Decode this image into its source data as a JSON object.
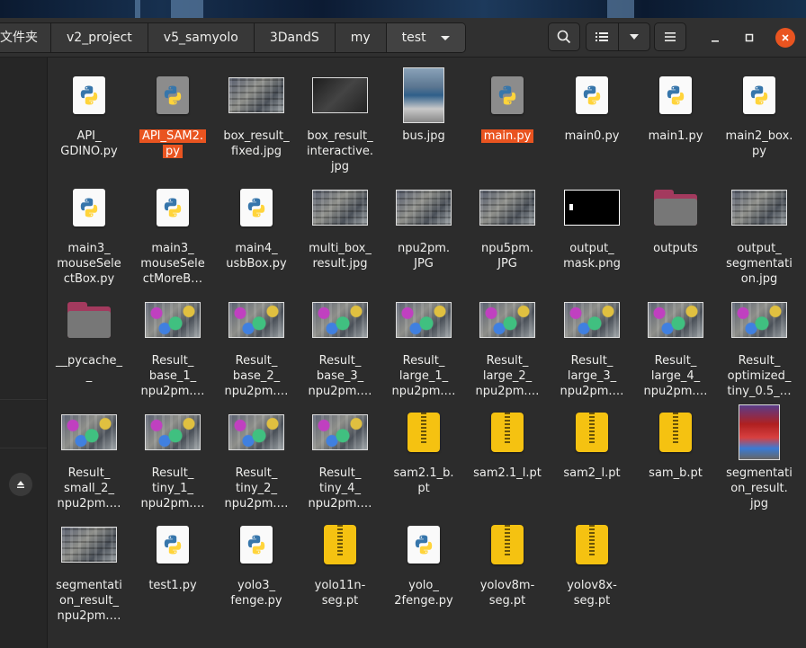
{
  "header": {
    "breadcrumbs": [
      "文件夹",
      "v2_project",
      "v5_samyolo",
      "3DandS",
      "my",
      "test"
    ]
  },
  "files": [
    {
      "label": "API_\nGDINO.py",
      "type": "python",
      "selected": false
    },
    {
      "label": "API_SAM2.\npy",
      "type": "python",
      "selected": true
    },
    {
      "label": "box_result_\nfixed.jpg",
      "type": "aerial",
      "selected": false
    },
    {
      "label": "box_result_\ninteractive.\njpg",
      "type": "dark",
      "selected": false
    },
    {
      "label": "bus.jpg",
      "type": "bus",
      "selected": false
    },
    {
      "label": "main.py",
      "type": "python",
      "selected": true
    },
    {
      "label": "main0.py",
      "type": "python",
      "selected": false
    },
    {
      "label": "main1.py",
      "type": "python",
      "selected": false
    },
    {
      "label": "main2_box.\npy",
      "type": "python",
      "selected": false
    },
    {
      "label": "main3_\nmouseSele\nctBox.py",
      "type": "python",
      "selected": false
    },
    {
      "label": "main3_\nmouseSele\nctMoreB…",
      "type": "python",
      "selected": false
    },
    {
      "label": "main4_\nusbBox.py",
      "type": "python",
      "selected": false
    },
    {
      "label": "multi_box_\nresult.jpg",
      "type": "aerial",
      "selected": false
    },
    {
      "label": "npu2pm.\nJPG",
      "type": "aerial",
      "selected": false
    },
    {
      "label": "npu5pm.\nJPG",
      "type": "aerial",
      "selected": false
    },
    {
      "label": "output_\nmask.png",
      "type": "mask",
      "selected": false
    },
    {
      "label": "outputs",
      "type": "folder",
      "selected": false
    },
    {
      "label": "output_\nsegmentati\non.jpg",
      "type": "aerial",
      "selected": false
    },
    {
      "label": "__pycache_\n_",
      "type": "folder",
      "selected": false
    },
    {
      "label": "Result_\nbase_1_\nnpu2pm.…",
      "type": "colored",
      "selected": false
    },
    {
      "label": "Result_\nbase_2_\nnpu2pm.…",
      "type": "colored",
      "selected": false
    },
    {
      "label": "Result_\nbase_3_\nnpu2pm.…",
      "type": "colored",
      "selected": false
    },
    {
      "label": "Result_\nlarge_1_\nnpu2pm.…",
      "type": "colored",
      "selected": false
    },
    {
      "label": "Result_\nlarge_2_\nnpu2pm.…",
      "type": "colored",
      "selected": false
    },
    {
      "label": "Result_\nlarge_3_\nnpu2pm.…",
      "type": "colored",
      "selected": false
    },
    {
      "label": "Result_\nlarge_4_\nnpu2pm.…",
      "type": "colored",
      "selected": false
    },
    {
      "label": "Result_\noptimized_\ntiny_0.5_…",
      "type": "colored",
      "selected": false
    },
    {
      "label": "Result_\nsmall_2_\nnpu2pm.…",
      "type": "colored",
      "selected": false
    },
    {
      "label": "Result_\ntiny_1_\nnpu2pm.…",
      "type": "colored",
      "selected": false
    },
    {
      "label": "Result_\ntiny_2_\nnpu2pm.…",
      "type": "colored",
      "selected": false
    },
    {
      "label": "Result_\ntiny_4_\nnpu2pm.…",
      "type": "colored",
      "selected": false
    },
    {
      "label": "sam2.1_b.\npt",
      "type": "archive",
      "selected": false
    },
    {
      "label": "sam2.1_l.pt",
      "type": "archive",
      "selected": false
    },
    {
      "label": "sam2_l.pt",
      "type": "archive",
      "selected": false
    },
    {
      "label": "sam_b.pt",
      "type": "archive",
      "selected": false
    },
    {
      "label": "segmentati\non_result.\njpg",
      "type": "segres",
      "selected": false
    },
    {
      "label": "segmentati\non_result_\nnpu2pm.…",
      "type": "aerial",
      "selected": false
    },
    {
      "label": "test1.py",
      "type": "python",
      "selected": false
    },
    {
      "label": "yolo3_\nfenge.py",
      "type": "python",
      "selected": false
    },
    {
      "label": "yolo11n-\nseg.pt",
      "type": "archive",
      "selected": false
    },
    {
      "label": "yolo_\n2fenge.py",
      "type": "python",
      "selected": false
    },
    {
      "label": "yolov8m-\nseg.pt",
      "type": "archive",
      "selected": false
    },
    {
      "label": "yolov8x-\nseg.pt",
      "type": "archive",
      "selected": false
    }
  ],
  "colors": {
    "selection": "#e95420",
    "background": "#2c2c2c",
    "archive": "#f5c211",
    "folder_tab": "#a33a5e"
  }
}
